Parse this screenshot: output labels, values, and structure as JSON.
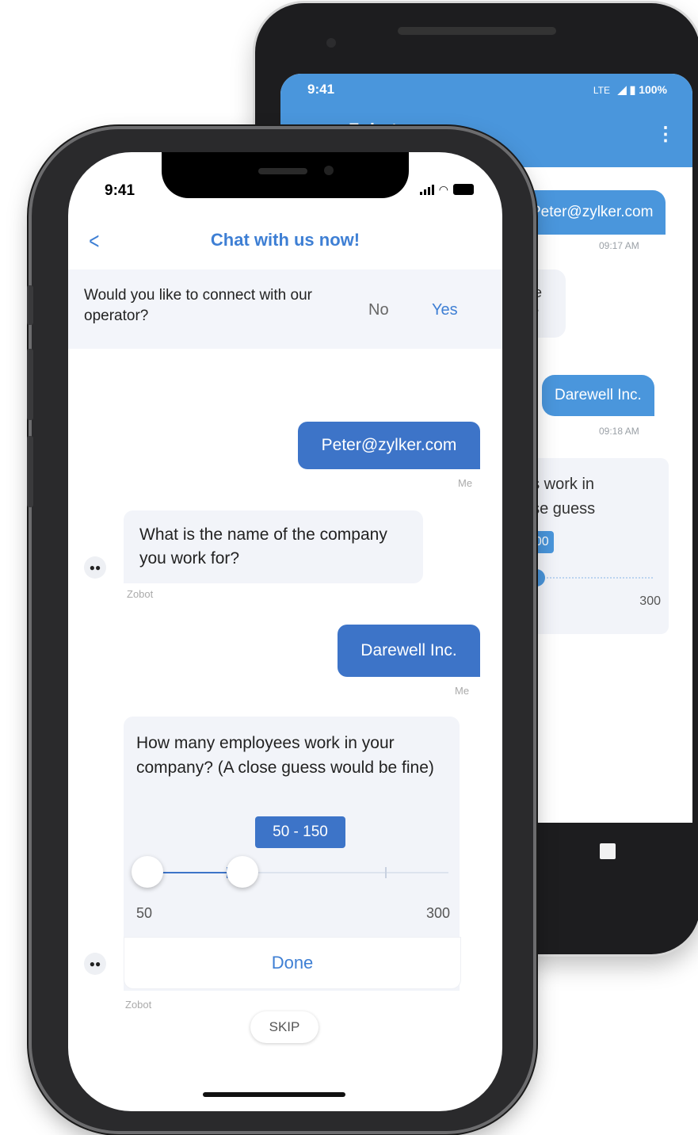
{
  "android": {
    "status_time": "9:41",
    "status_network": "LTE",
    "status_battery": "100%",
    "title": "Zobot",
    "messages": [
      {
        "text": "Peter@zylker.com",
        "time": "09:17 AM"
      },
      {
        "text": "Darewell Inc.",
        "time": "09:18 AM"
      }
    ],
    "bot_fragment": [
      "he",
      "r?"
    ],
    "card_fragment": [
      "es work in",
      "ose guess"
    ],
    "slider_value": "200",
    "slider_max": "300"
  },
  "ios": {
    "status_time": "9:41",
    "header_title": "Chat with us now!",
    "banner": {
      "question": "Would you like to connect with our operator?",
      "no_label": "No",
      "yes_label": "Yes"
    },
    "messages": {
      "user_email": "Peter@zylker.com",
      "me_label": "Me",
      "bot_question_company": "What is the name of the company you work for?",
      "bot_label": "Zobot",
      "user_company": "Darewell Inc.",
      "bot_question_employees": "How many employees work in your company? (A close guess would be fine)"
    },
    "slider": {
      "range_label": "50 - 150",
      "min_label": "50",
      "max_label": "300",
      "min": 50,
      "max": 300,
      "low": 50,
      "high": 150
    },
    "done_label": "Done",
    "skip_label": "SKIP"
  },
  "colors": {
    "android_accent": "#4a96dc",
    "ios_accent": "#3e7fd4",
    "user_bubble": "#3d74c8"
  },
  "icons": [
    "back-arrow-icon",
    "more-vertical-icon",
    "signal-icon",
    "wifi-icon",
    "battery-icon",
    "bot-avatar-icon"
  ]
}
